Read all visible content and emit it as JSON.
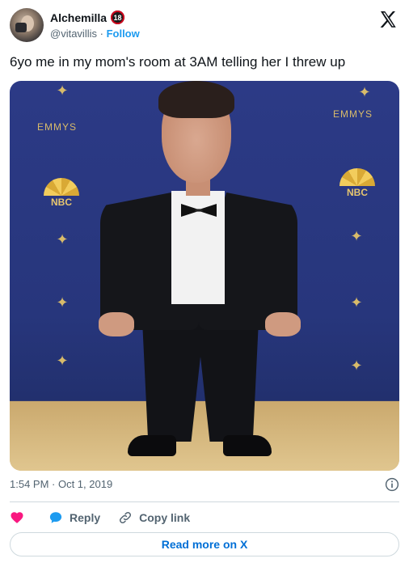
{
  "author": {
    "display_name": "Alchemilla",
    "badge": "18",
    "handle": "@vitavillis",
    "separator": "·",
    "follow_label": "Follow"
  },
  "tweet": {
    "text": "6yo me in my mom's room at 3AM telling her I threw up",
    "timestamp": "1:54 PM · Oct 1, 2019"
  },
  "media": {
    "logos": {
      "emmys": "EMMYS",
      "nbc": "NBC"
    }
  },
  "actions": {
    "heart_icon": "heart-icon",
    "reply_label": "Reply",
    "copy_label": "Copy link"
  },
  "footer": {
    "read_more_label": "Read more on X"
  },
  "colors": {
    "accent": "#1d9bf0",
    "heart": "#f91880",
    "link_blue": "#006fd6",
    "muted_text": "#536471",
    "backdrop_blue": "#2a3780",
    "carpet_gold": "#d2b57e"
  }
}
